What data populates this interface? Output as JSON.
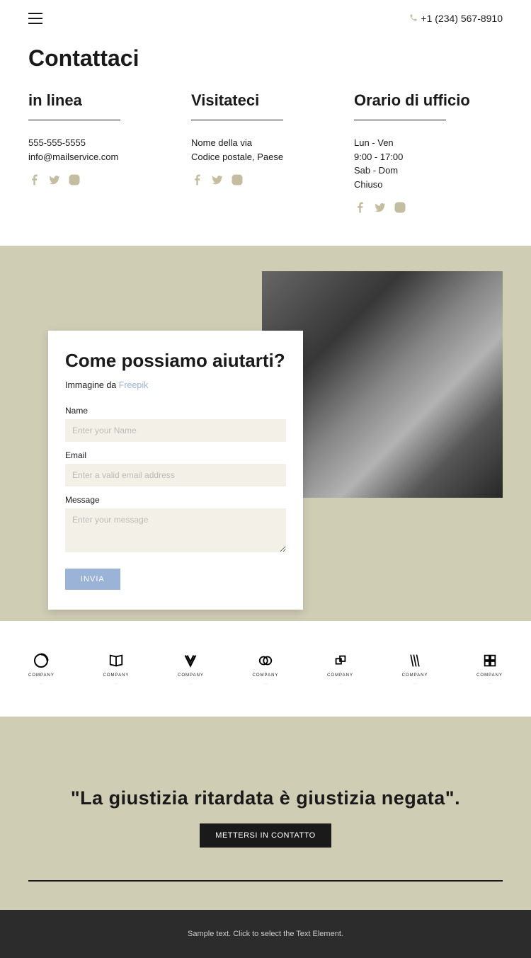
{
  "header": {
    "phone": "+1 (234) 567-8910"
  },
  "contact": {
    "title": "Contattaci",
    "cols": [
      {
        "title": "in linea",
        "line1": "555-555-5555",
        "line2": "info@mailservice.com"
      },
      {
        "title": "Visitateci",
        "line1": "Nome della via",
        "line2": "Codice postale, Paese"
      },
      {
        "title": "Orario di ufficio",
        "line1": "Lun - Ven",
        "line2": "9:00 - 17:00",
        "line3": "Sab - Dom",
        "line4": "Chiuso"
      }
    ]
  },
  "form": {
    "title": "Come possiamo aiutarti?",
    "sub_prefix": "Immagine da ",
    "sub_link": "Freepik",
    "name_label": "Name",
    "name_placeholder": "Enter your Name",
    "email_label": "Email",
    "email_placeholder": "Enter a valid email address",
    "message_label": "Message",
    "message_placeholder": "Enter your message",
    "submit": "INVIA"
  },
  "logos": {
    "label": "COMPANY"
  },
  "quote": {
    "text": "\"La giustizia ritardata è giustizia negata\".",
    "button": "METTERSI IN CONTATTO"
  },
  "footer": {
    "text": "Sample text. Click to select the Text Element."
  }
}
